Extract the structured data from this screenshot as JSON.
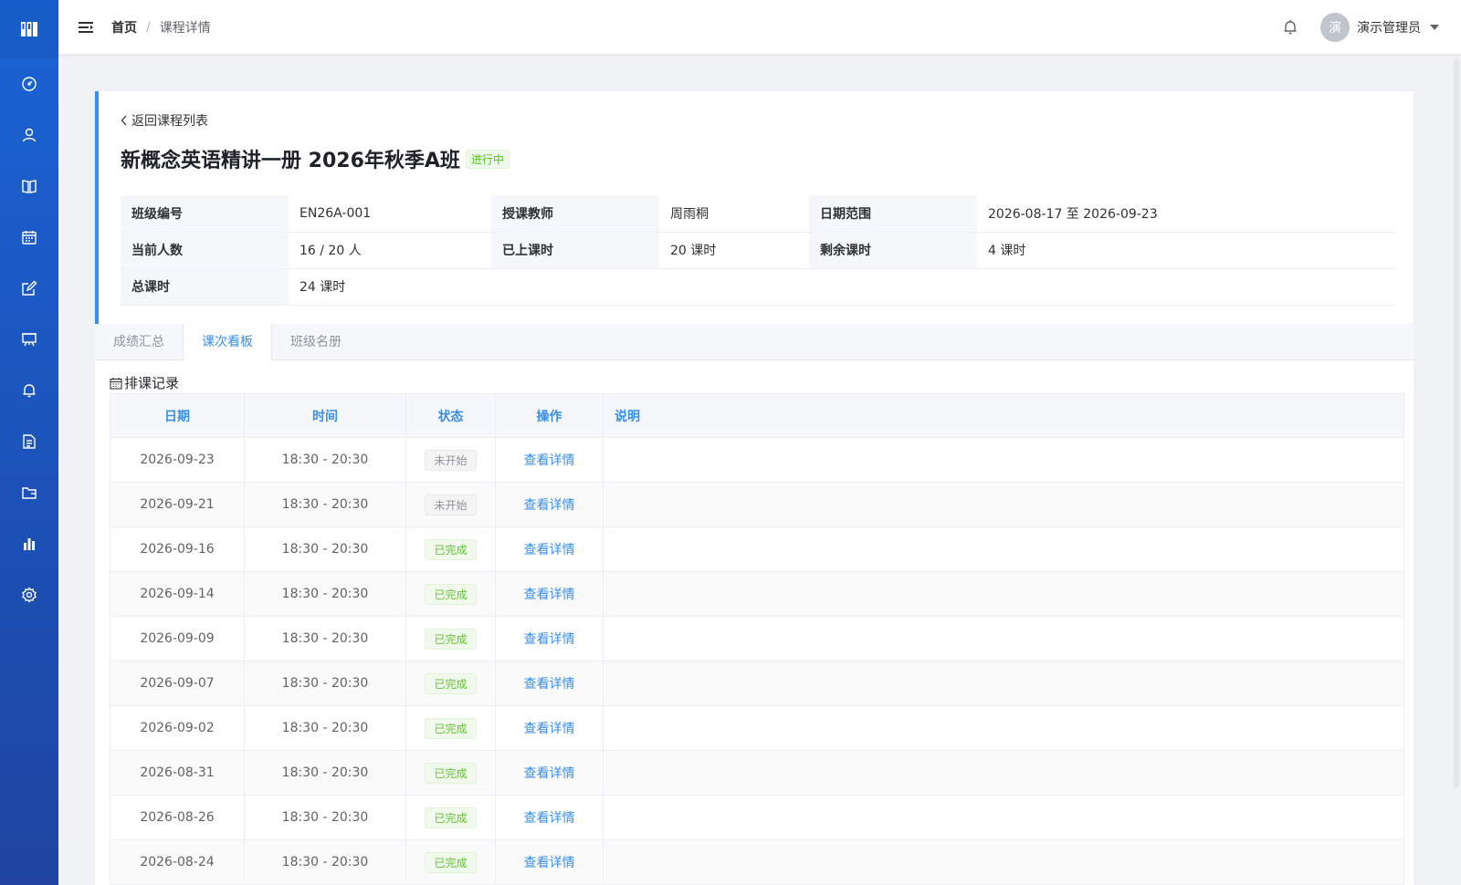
{
  "header": {
    "breadcrumb_home": "首页",
    "breadcrumb_sep": "/",
    "breadcrumb_current": "课程详情",
    "avatar_text": "演",
    "user_name": "演示管理员"
  },
  "sidebar": {
    "items": [
      "dashboard-icon",
      "user-icon",
      "book-icon",
      "calendar-icon",
      "edit-icon",
      "board-icon",
      "bell-icon",
      "document-icon",
      "folder-icon",
      "chart-icon",
      "gear-icon"
    ]
  },
  "course": {
    "back_label": "返回课程列表",
    "title": "新概念英语精讲一册 2026年秋季A班",
    "status": "进行中",
    "info": {
      "class_code_label": "班级编号",
      "class_code": "EN26A-001",
      "teacher_label": "授课教师",
      "teacher": "周雨桐",
      "date_range_label": "日期范围",
      "date_range": "2026-08-17 至 2026-09-23",
      "current_count_label": "当前人数",
      "current_count": "16 / 20 人",
      "taught_label": "已上课时",
      "taught": "20 课时",
      "remaining_label": "剩余课时",
      "remaining": "4 课时",
      "total_label": "总课时",
      "total": "24 课时"
    }
  },
  "tabs": [
    "成绩汇总",
    "课次看板",
    "班级名册"
  ],
  "schedule": {
    "title": "排课记录",
    "columns": [
      "日期",
      "时间",
      "状态",
      "操作",
      "说明"
    ],
    "rows": [
      {
        "date": "2026-09-23",
        "time": "18:30 - 20:30",
        "status": "未开始",
        "action": "查看详情",
        "note": ""
      },
      {
        "date": "2026-09-21",
        "time": "18:30 - 20:30",
        "status": "未开始",
        "action": "查看详情",
        "note": ""
      },
      {
        "date": "2026-09-16",
        "time": "18:30 - 20:30",
        "status": "已完成",
        "action": "查看详情",
        "note": ""
      },
      {
        "date": "2026-09-14",
        "time": "18:30 - 20:30",
        "status": "已完成",
        "action": "查看详情",
        "note": ""
      },
      {
        "date": "2026-09-09",
        "time": "18:30 - 20:30",
        "status": "已完成",
        "action": "查看详情",
        "note": ""
      },
      {
        "date": "2026-09-07",
        "time": "18:30 - 20:30",
        "status": "已完成",
        "action": "查看详情",
        "note": ""
      },
      {
        "date": "2026-09-02",
        "time": "18:30 - 20:30",
        "status": "已完成",
        "action": "查看详情",
        "note": ""
      },
      {
        "date": "2026-08-31",
        "time": "18:30 - 20:30",
        "status": "已完成",
        "action": "查看详情",
        "note": ""
      },
      {
        "date": "2026-08-26",
        "time": "18:30 - 20:30",
        "status": "已完成",
        "action": "查看详情",
        "note": ""
      },
      {
        "date": "2026-08-24",
        "time": "18:30 - 20:30",
        "status": "已完成",
        "action": "查看详情",
        "note": ""
      }
    ]
  },
  "colors": {
    "accent": "#3a8ee6",
    "sidebar": "#1c52b8",
    "done": "#67c23a",
    "pending": "#909399"
  }
}
